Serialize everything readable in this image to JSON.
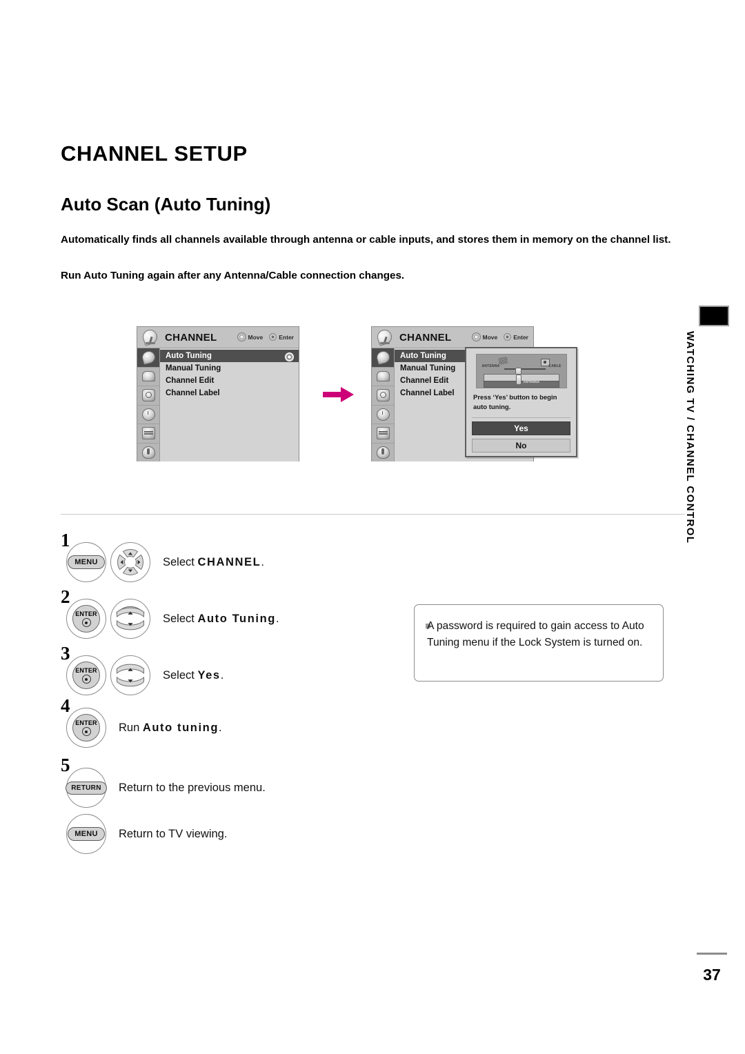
{
  "document": {
    "heading": "CHANNEL SETUP",
    "subheading": "Auto Scan (Auto Tuning)",
    "intro_paragraph": "Automatically finds all channels available through antenna or cable inputs, and stores them in memory on the channel list.",
    "intro_paragraph_2": "Run Auto Tuning again after any Antenna/Cable connection changes.",
    "side_tab_text": "WATCHING TV / CHANNEL CONTROL",
    "page_number": "37"
  },
  "arrow": {
    "name": "flow-arrow",
    "color": "#cc0077"
  },
  "tv_menu_1": {
    "title": "CHANNEL",
    "hint_move": "Move",
    "hint_enter": "Enter",
    "items": [
      {
        "label": "Auto Tuning",
        "selected": true
      },
      {
        "label": "Manual Tuning",
        "selected": false
      },
      {
        "label": "Channel Edit",
        "selected": false
      },
      {
        "label": "Channel Label",
        "selected": false
      }
    ],
    "rail_icons": [
      "satellite-dish-icon",
      "picture-icon",
      "audio-icon",
      "time-icon",
      "option-icon",
      "lock-icon"
    ]
  },
  "tv_menu_2": {
    "title": "CHANNEL",
    "hint_move": "Move",
    "hint_enter": "Enter",
    "items": [
      {
        "label": "Auto Tuning",
        "selected": true
      },
      {
        "label": "Manual Tuning",
        "selected": false
      },
      {
        "label": "Channel Edit",
        "selected": false
      },
      {
        "label": "Channel Label",
        "selected": false
      }
    ],
    "dialog": {
      "graphic_antenna_label": "ANTENNA",
      "graphic_cable_label": "CABLE",
      "graphic_input_label": "ANTENNA",
      "message": "Press ‘Yes’ button to begin auto tuning.",
      "yes_label": "Yes",
      "no_label": "No"
    }
  },
  "steps": [
    {
      "number": "1",
      "button_label": "MENU",
      "control": "four-way-wheel",
      "text_prefix": "Select ",
      "text_emphasis": "CHANNEL",
      "text_suffix": "."
    },
    {
      "number": "2",
      "button_label": "ENTER",
      "control": "up-down-rocker",
      "text_prefix": "Select ",
      "text_emphasis": "Auto Tuning",
      "text_suffix": "."
    },
    {
      "number": "3",
      "button_label": "ENTER",
      "control": "up-down-rocker",
      "text_prefix": "Select ",
      "text_emphasis": "Yes",
      "text_suffix": "."
    },
    {
      "number": "4",
      "button_label": "ENTER",
      "control": "none",
      "text_prefix": "Run ",
      "text_emphasis": "Auto tuning",
      "text_suffix": "."
    },
    {
      "number": "5",
      "button_label": "RETURN",
      "control": "none",
      "text_prefix": "Return to the previous menu.",
      "text_emphasis": "",
      "text_suffix": ""
    },
    {
      "number": "",
      "button_label": "MENU",
      "control": "none",
      "text_prefix": "Return to TV viewing.",
      "text_emphasis": "",
      "text_suffix": ""
    }
  ],
  "note": {
    "bullet": "square-bullet",
    "text": "A password is required to gain access to Auto Tuning menu if the Lock System is turned on."
  }
}
